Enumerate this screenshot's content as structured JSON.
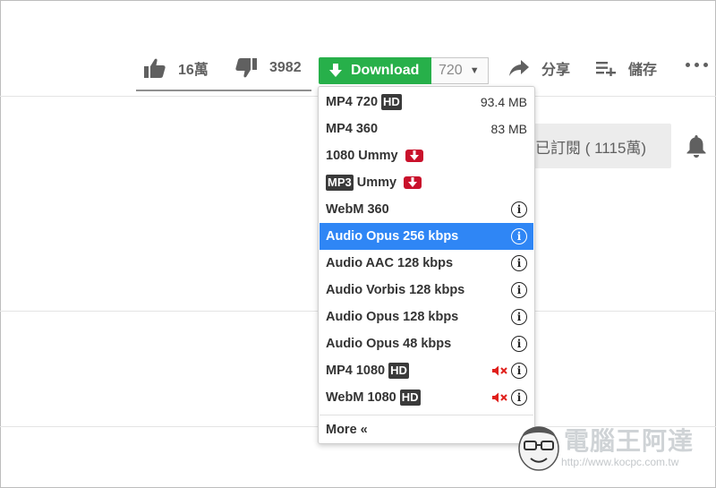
{
  "actions": {
    "like_count": "16萬",
    "dislike_count": "3982",
    "share_label": "分享",
    "save_label": "儲存"
  },
  "download": {
    "button_label": "Download",
    "quality_value": "720",
    "button_color": "#27b04a"
  },
  "subscribe": {
    "label": "已訂閱 ( 1115萬)"
  },
  "menu": {
    "items": [
      {
        "format": "MP4 720",
        "badge": "HD",
        "size": "93.4 MB"
      },
      {
        "format": "MP4 360",
        "size": "83 MB"
      },
      {
        "format": "1080 Ummy",
        "icon": "ummy-download-icon"
      },
      {
        "badge": "MP3",
        "format": "Ummy",
        "icon": "ummy-download-icon"
      },
      {
        "format": "WebM 360",
        "icon": "info-icon"
      },
      {
        "format": "Audio Opus 256 kbps",
        "icon": "info-icon",
        "selected": true
      },
      {
        "format": "Audio AAC 128 kbps",
        "icon": "info-icon"
      },
      {
        "format": "Audio Vorbis 128 kbps",
        "icon": "info-icon"
      },
      {
        "format": "Audio Opus 128 kbps",
        "icon": "info-icon"
      },
      {
        "format": "Audio Opus 48 kbps",
        "icon": "info-icon"
      },
      {
        "format": "MP4 1080",
        "badge": "HD",
        "icon": "muted-speaker-icon"
      },
      {
        "format": "WebM 1080",
        "badge": "HD",
        "icon": "muted-speaker-icon"
      }
    ],
    "more_label": "More «",
    "selected_color": "#2f86f5"
  },
  "watermark": {
    "title": "電腦王阿達",
    "url": "http://www.kocpc.com.tw"
  }
}
